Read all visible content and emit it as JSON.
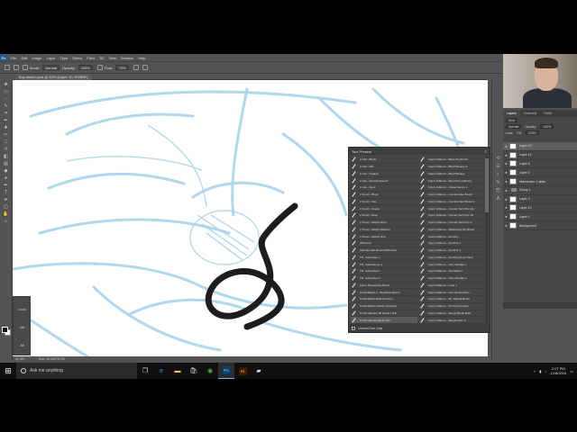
{
  "app": {
    "logo": "Ps",
    "menus": [
      "File",
      "Edit",
      "Image",
      "Layer",
      "Type",
      "Select",
      "Filter",
      "3D",
      "View",
      "Window",
      "Help"
    ]
  },
  "options_bar": {
    "mode_label": "Mode:",
    "mode_value": "Normal",
    "opacity_label": "Opacity:",
    "opacity_value": "100%",
    "flow_label": "Flow:",
    "flow_value": "70%"
  },
  "document": {
    "tab_title": "Boy sketch.psd @ 62% (Layer 10, RGB/8*)",
    "status_zoom": "62.5%",
    "status_doc": "Doc: 10.1M/76.7M"
  },
  "tablet_panel": {
    "buttons": [
      "Undo",
      "Ctrl",
      "Alt"
    ]
  },
  "tool_presets": {
    "title": "Tool Presets",
    "col1": [
      "z Inks - Brush",
      "z Inks - Nib",
      "z Inks - Organic",
      "z Inks - Smooth Round",
      "z Inks - Sumi",
      "z Pencil - Brush",
      "z Pencil - Flat",
      "z Pencil - Grainy",
      "z Pencil - Real",
      "z Pencil - Sketch Hard",
      "z Pencil - Sketch Medium",
      "z Pencil - Sketch Soft",
      "2B Pencil",
      "Ultimate Soft Round 90% Flow",
      "TB - Add noise 1",
      "TB - Add Canvas 1",
      "TB - add noise 2",
      "TB - add noise 3",
      "Kyle's Perspective Brush",
      "KYLE Basics 1 - Big Bold Hatcher",
      "KYLE Basics Balloonie Pen",
      "KYLE Basics Charity Charcoal",
      "KYLE Ultimate 2B Pencil 1 Bar",
      "KYLE Ultimate Brush Pen"
    ],
    "col2": [
      "Kyle's Gibbons - Bone Dry Brush",
      "Kyle's Gibbons - Brush Beauty 2",
      "Kyle's Gibbons - Brush Beauty",
      "Kyle's Gibbons - Brush Pen with Dry",
      "Kyle's Gibbons - Chaos Gonzo 1",
      "Kyle's Gibbons - Comics Inker Brush",
      "Kyle's Gibbons - Comics Inker Brush 2",
      "Kyle's Gibbons - Comics Tech Pen Ink",
      "Kyle's Gibbons - Comics Tech Pen 10",
      "Kyle's Gibbons - Comics Tech Pen 3",
      "Kyle's Gibbons - Deliciously Dry Brush",
      "Kyle's Gibbons - Do Dirty",
      "Kyle's Gibbons - Do Dirty 2",
      "Kyle's Gibbons - Do Dirty 3",
      "Kyle's Gibbons - Do Dirty Pencil Tech",
      "Kyle's Gibbons - Dirty Doodler 1",
      "Kyle's Gibbons - Dot Mask 1",
      "Kyle's Gibbons - Dirty Doodler 1",
      "Kyle's Gibbons - Lotar 1",
      "Kyle's Gibbons - Lino Ink Red Pen",
      "Kyle's Gibbons - Mr. Natural Brush",
      "Kyle's Gibbons - PS Pencil Grass",
      "Kyle's Gibbons - Rough Brush Bold",
      "Kyle's Gibbons - Rough Inker 2"
    ],
    "selected_index": 23,
    "footer": "Current Tool Only"
  },
  "right_panels": {
    "info_text": "Doc: 10.1M/76.7M\nClick and drag to paint using foreground color. Use Shift, Alt, and Ctrl for additional options.",
    "brush_presets_title": "Brush Presets",
    "tabs": [
      "Layers",
      "Channels",
      "Paths"
    ],
    "kind_label": "Kind",
    "blend_mode": "Normal",
    "opacity_label": "Opacity:",
    "opacity_value": "100%",
    "lock_label": "Lock:",
    "fill_label": "Fill:",
    "fill_value": "100%",
    "layers": [
      {
        "name": "Layer 10",
        "type": "layer",
        "selected": true
      },
      {
        "name": "Layer 14",
        "type": "layer",
        "selected": false
      },
      {
        "name": "Layer 6",
        "type": "layer",
        "selected": false
      },
      {
        "name": "Layer 2",
        "type": "layer",
        "selected": false
      },
      {
        "name": "Hide/under 1 slider",
        "type": "layer",
        "selected": false
      },
      {
        "name": "Group 1",
        "type": "group",
        "selected": false
      },
      {
        "name": "Layer 3",
        "type": "layer",
        "selected": false
      },
      {
        "name": "Layer 12",
        "type": "layer",
        "selected": false
      },
      {
        "name": "Layer 1",
        "type": "layer",
        "selected": false
      },
      {
        "name": "Background",
        "type": "layer",
        "selected": false
      }
    ]
  },
  "taskbar": {
    "search_placeholder": "Ask me anything",
    "time": "2:07 PM",
    "date": "12/8/2016"
  },
  "colors": {
    "sketch_blue": "#a9d3ec",
    "ink": "#1c1c1c",
    "panel_bg": "#535353"
  }
}
